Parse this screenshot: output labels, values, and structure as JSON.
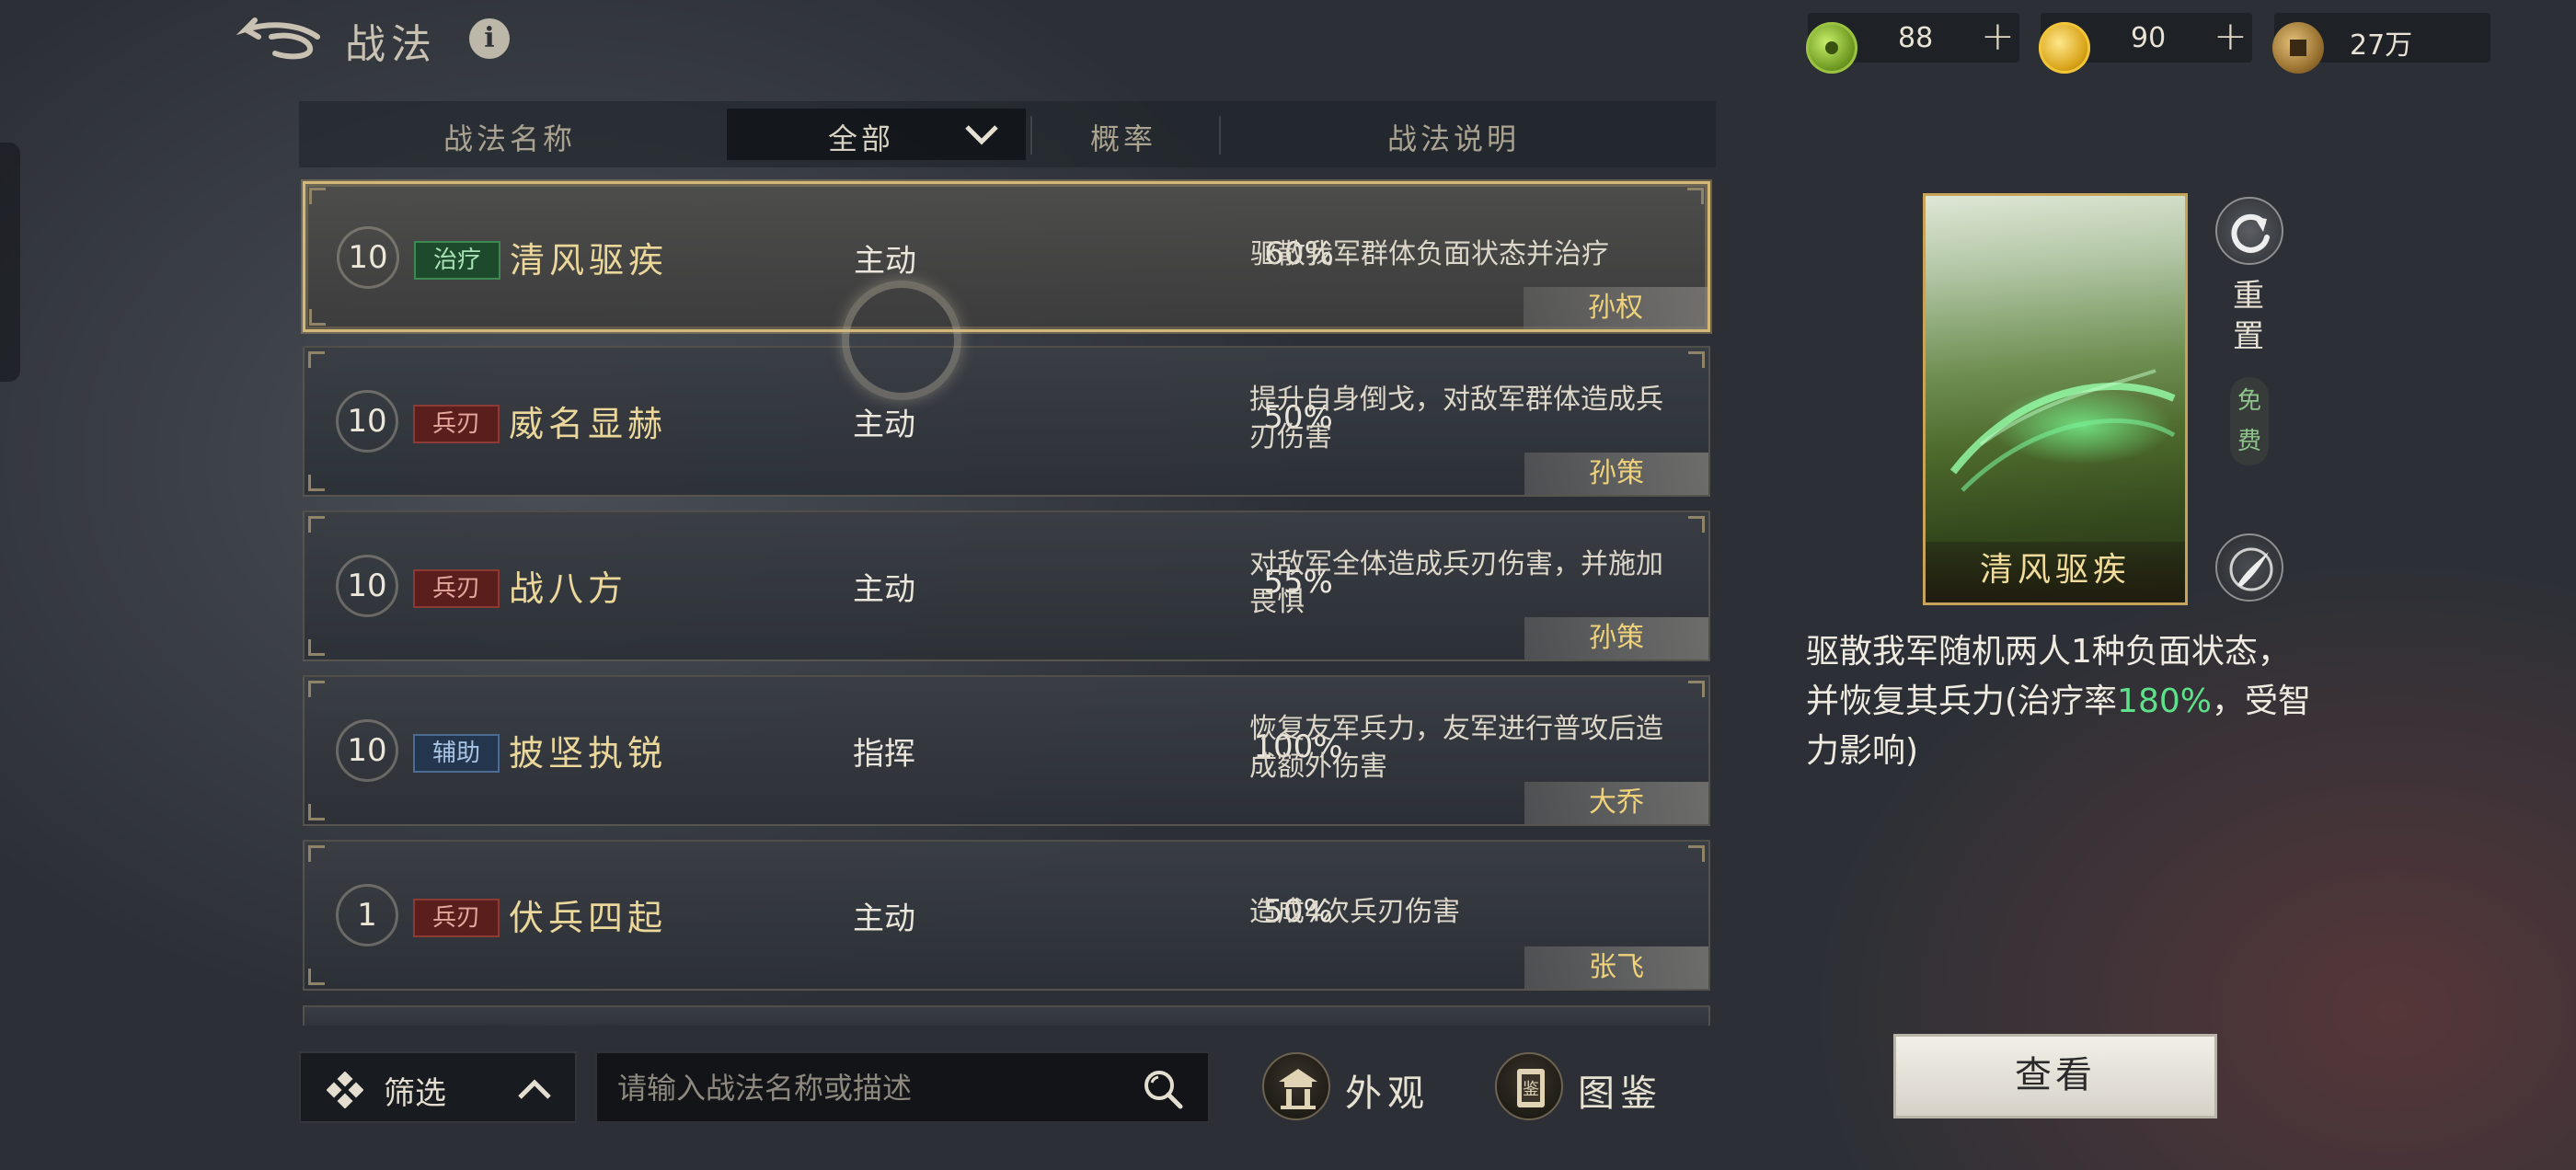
{
  "header": {
    "title": "战法",
    "info_icon": "i"
  },
  "resources": [
    {
      "icon": "jade-coin-icon",
      "value": "88",
      "plus": "+"
    },
    {
      "icon": "gold-coin-icon",
      "value": "90",
      "plus": "+"
    },
    {
      "icon": "copper-coin-icon",
      "value": "27万"
    }
  ],
  "table": {
    "col_name": "战法名称",
    "col_filter_value": "全部",
    "col_prob": "概率",
    "col_desc": "战法说明"
  },
  "rows": [
    {
      "level": "10",
      "tag": "治疗",
      "tag_kind": "heal",
      "name": "清风驱疾",
      "type": "主动",
      "prob": "60%",
      "desc": "驱散我军群体负面状态并治疗",
      "hero": "孙权",
      "selected": true
    },
    {
      "level": "10",
      "tag": "兵刃",
      "tag_kind": "blade",
      "name": "威名显赫",
      "type": "主动",
      "prob": "50%",
      "desc": "提升自身倒戈，对敌军群体造成兵刃伤害",
      "hero": "孙策"
    },
    {
      "level": "10",
      "tag": "兵刃",
      "tag_kind": "blade",
      "name": "战八方",
      "type": "主动",
      "prob": "55%",
      "desc": "对敌军全体造成兵刃伤害，并施加畏惧",
      "hero": "孙策"
    },
    {
      "level": "10",
      "tag": "辅助",
      "tag_kind": "assist",
      "name": "披坚执锐",
      "type": "指挥",
      "prob": "100%",
      "desc": "恢复友军兵力，友军进行普攻后造成额外伤害",
      "hero": "大乔"
    },
    {
      "level": "1",
      "tag": "兵刃",
      "tag_kind": "blade",
      "name": "伏兵四起",
      "type": "主动",
      "prob": "50%",
      "desc": "造成4次兵刃伤害",
      "hero": "张飞"
    }
  ],
  "bottom": {
    "filter_label": "筛选",
    "search_placeholder": "请输入战法名称或描述",
    "appearance_label": "外观",
    "codex_label": "图鉴"
  },
  "detail": {
    "card_name": "清风驱疾",
    "reset_label": "重置",
    "free_label": "免费",
    "desc_before": "驱散我军随机两人1种负面状态，并恢复其兵力(治疗率",
    "desc_highlight": "180%",
    "desc_after": "，受智力影响)",
    "view_button": "查看"
  },
  "colors": {
    "accent_gold": "#ecd79b",
    "selected_border": "#d4b877",
    "highlight_green": "#5fe08a"
  }
}
